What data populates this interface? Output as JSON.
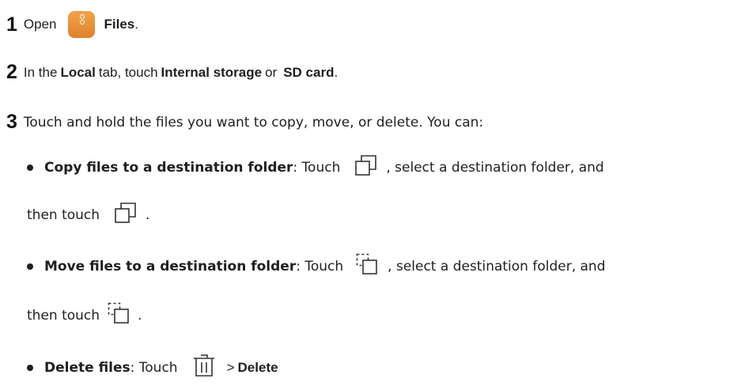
{
  "steps": [
    {
      "num": "1",
      "prefix": "Open",
      "app": "Files",
      "suffix": "."
    },
    {
      "num": "2",
      "t1": "In the",
      "b1": "Local",
      "t2": "tab, touch",
      "b2": "Internal storage",
      "t3": "or",
      "b3": "SD card",
      "t4": "."
    },
    {
      "num": "3",
      "text": "Touch and hold the files you want to copy, move, or delete. You can:"
    }
  ],
  "bullets": [
    {
      "title": "Copy files to a destination folder",
      "mid": ": Touch",
      "after": ", select a destination folder, and",
      "cont": "then touch",
      "end": "."
    },
    {
      "title": "Move files to a destination folder",
      "mid": ": Touch",
      "after": ", select a destination folder, and",
      "cont": "then touch",
      "end": "."
    },
    {
      "title": "Delete files",
      "mid": ": Touch",
      "arrow": ">",
      "action": "Delete"
    }
  ],
  "icons": {
    "files_app": "files-app-icon",
    "copy": "copy-icon",
    "move": "move-icon",
    "delete": "trash-icon"
  },
  "colors": {
    "files_app": "#e8912f"
  }
}
